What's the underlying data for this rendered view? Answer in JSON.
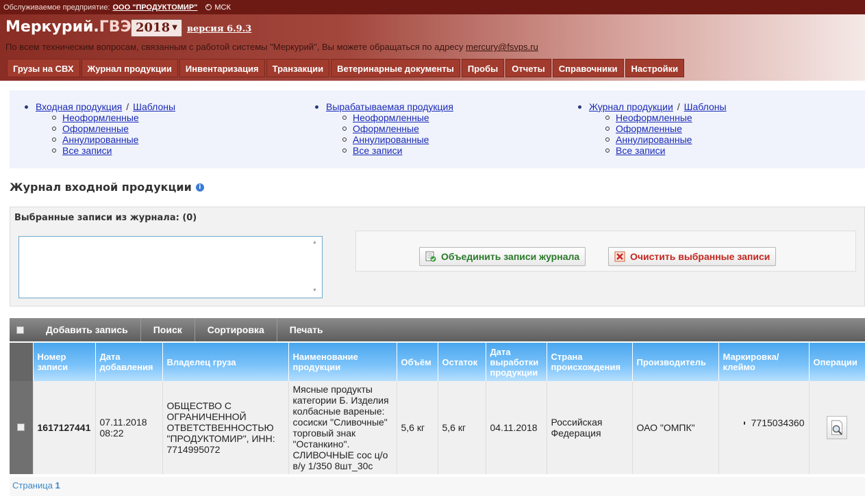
{
  "topbar": {
    "prefix": "Обслуживаемое предприятие:",
    "company": "ООО \"ПРОДУКТОМИР\"",
    "timezone": "МСК"
  },
  "header": {
    "logo_main": "Меркурий.",
    "logo_sub": "ГВЭ",
    "year": "2018",
    "version": "версия 6.9.3",
    "support_text": "По всем техническим вопросам, связанным с работой системы \"Меркурий\", Вы можете обращаться по адресу",
    "support_email": "mercury@fsvps.ru"
  },
  "nav": [
    "Грузы на СВХ",
    "Журнал продукции",
    "Инвентаризация",
    "Транзакции",
    "Ветеринарные документы",
    "Пробы",
    "Отчеты",
    "Справочники",
    "Настройки"
  ],
  "links": {
    "col1": {
      "main": "Входная продукция ",
      "templates": "Шаблоны",
      "items": [
        "Неоформленные",
        "Оформленные",
        "Аннулированные",
        "Все записи"
      ]
    },
    "col2": {
      "main": "Вырабатываемая продукция",
      "items": [
        "Неоформленные",
        "Оформленные",
        "Аннулированные",
        "Все записи"
      ]
    },
    "col3": {
      "main": "Журнал продукции ",
      "templates": "Шаблоны",
      "items": [
        "Неоформленные",
        "Оформленные",
        "Аннулированные",
        "Все записи"
      ]
    }
  },
  "journal": {
    "title": "Журнал входной продукции",
    "selected_label": "Выбранные записи из журнала: (0)",
    "merge_button": "Объединить записи журнала",
    "clear_button": "Очистить выбранные записи"
  },
  "toolbar": {
    "add": "Добавить запись",
    "search": "Поиск",
    "sort": "Сортировка",
    "print": "Печать"
  },
  "table": {
    "columns": [
      "Номер записи",
      "Дата добавления",
      "Владелец груза",
      "Наименование продукции",
      "Объём",
      "Остаток",
      "Дата выработки продукции",
      "Страна происхождения",
      "Производитель",
      "Маркировка/ клеймо",
      "Операции"
    ],
    "rows": [
      {
        "number": "1617127441",
        "date_added": "07.11.2018 08:22",
        "owner": "ОБЩЕСТВО С ОГРАНИЧЕННОЙ ОТВЕТСТВЕННОСТЬЮ \"ПРОДУКТОМИР\", ИНН: 7714995072",
        "product": "Мясные продукты категории Б. Изделия колбасные вареные: сосиски \"Сливочные\" торговый знак \"Останкино\". СЛИВОЧНЫЕ сос ц/о в/у 1/350 8шт_30с",
        "volume": "5,6 кг",
        "remainder": "5,6 кг",
        "production_date": "04.11.2018",
        "country": "Российская Федерация",
        "producer": "ОАО \"ОМПК\"",
        "marking": "7715034360"
      }
    ]
  },
  "pager": {
    "label": "Страница",
    "current": "1"
  }
}
